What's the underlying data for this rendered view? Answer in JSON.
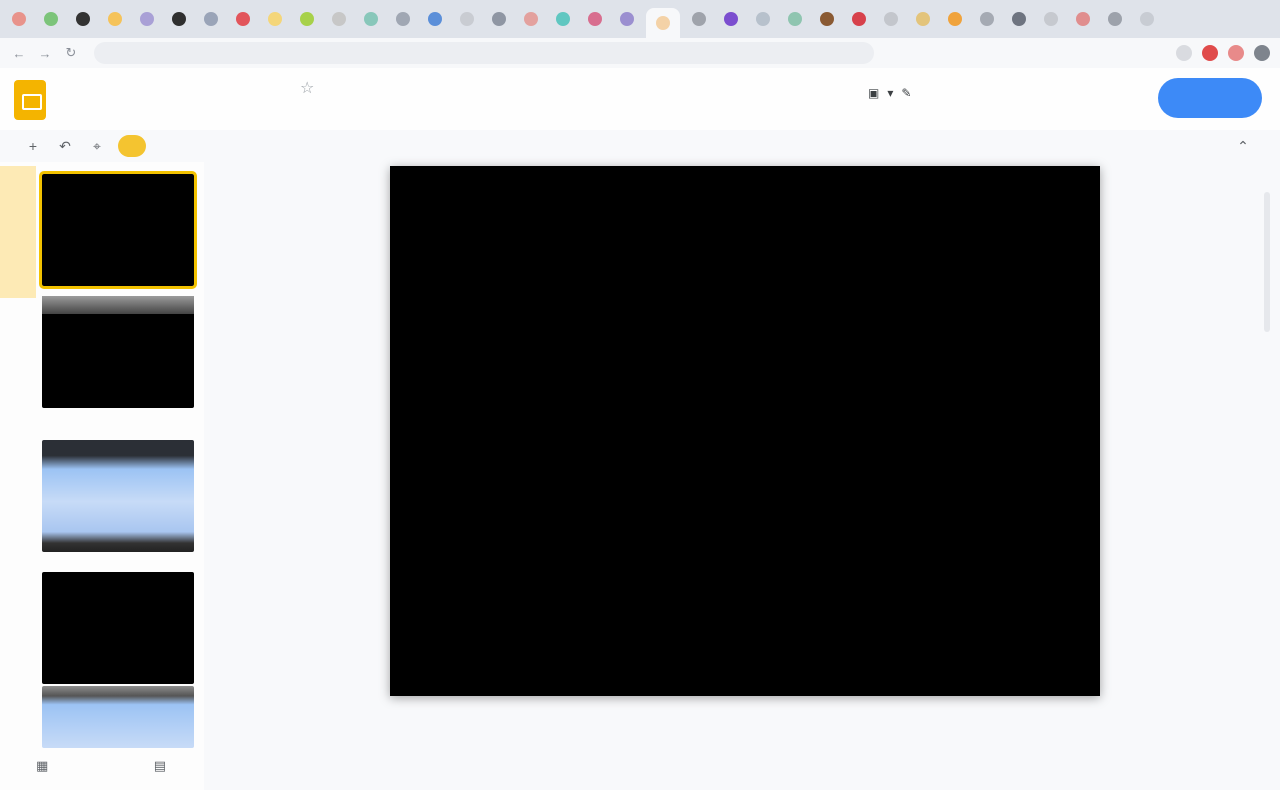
{
  "browser": {
    "tabs": [
      {
        "color": "#e8938b",
        "name": "red-circle-icon"
      },
      {
        "color": "#7cc47a",
        "name": "green-circle-icon"
      },
      {
        "color": "#333333",
        "name": "dark-circle-icon"
      },
      {
        "color": "#f5c35a",
        "name": "yellow-circle-icon"
      },
      {
        "color": "#a9a0d6",
        "name": "purple-circle-icon"
      },
      {
        "color": "#2f2f2f",
        "name": "github-icon"
      },
      {
        "color": "#9aa4b8",
        "name": "gray-circle-icon"
      },
      {
        "color": "#e2555b",
        "name": "red-circle-icon"
      },
      {
        "color": "#f4d67a",
        "name": "yellow-circle-icon"
      },
      {
        "color": "#a7d14a",
        "name": "lime-circle-icon"
      },
      {
        "color": "#c7c7c7",
        "name": "gray-circle-icon"
      },
      {
        "color": "#88c7ba",
        "name": "teal-circle-icon"
      },
      {
        "color": "#a0a7b3",
        "name": "gray-circle-icon"
      },
      {
        "color": "#5b8fd9",
        "name": "blue-circle-icon"
      },
      {
        "color": "#c9ccd2",
        "name": "gray-circle-icon"
      },
      {
        "color": "#8f96a3",
        "name": "gray-circle-icon"
      },
      {
        "color": "#e3a19e",
        "name": "pink-circle-icon"
      },
      {
        "color": "#60c7c1",
        "name": "teal-circle-icon"
      },
      {
        "color": "#d86e8f",
        "name": "pink-circle-icon"
      },
      {
        "color": "#9b8fd0",
        "name": "purple-circle-icon"
      },
      {
        "color": "#f4d2a7",
        "name": "slides-icon"
      },
      {
        "color": "#9fa3ab",
        "name": "gray-circle-icon"
      },
      {
        "color": "#7b4ecf",
        "name": "purple-circle-icon"
      },
      {
        "color": "#b7c1cc",
        "name": "gray-circle-icon"
      },
      {
        "color": "#8fc5b0",
        "name": "teal-circle-icon"
      },
      {
        "color": "#8a5a33",
        "name": "brown-circle-icon"
      },
      {
        "color": "#d7414b",
        "name": "red-circle-icon"
      },
      {
        "color": "#c3c6cc",
        "name": "gray-circle-icon"
      },
      {
        "color": "#e3c47b",
        "name": "yellow-circle-icon"
      },
      {
        "color": "#f0a33c",
        "name": "orange-circle-icon"
      },
      {
        "color": "#a5aab3",
        "name": "gray-circle-icon"
      },
      {
        "color": "#6e7480",
        "name": "gray-circle-icon"
      },
      {
        "color": "#c6c9cf",
        "name": "gray-circle-icon"
      },
      {
        "color": "#e08e8e",
        "name": "pink-circle-icon"
      },
      {
        "color": "#9da2ab",
        "name": "gray-circle-icon"
      },
      {
        "color": "#c8ccd3",
        "name": "gray-circle-icon"
      }
    ],
    "active_tab_index": 20,
    "extension_colors": [
      "#d9dbe0",
      "#e04b4b",
      "#e88a8a",
      "#7e848d"
    ]
  },
  "app": {
    "accent": "#f4b400",
    "share_color": "#3d8af7"
  },
  "thumbnails": [
    {
      "style": "black",
      "selected": true
    },
    {
      "style": "gray-top"
    },
    {
      "style": "blue"
    },
    {
      "style": "black"
    },
    {
      "style": "blue-partial"
    }
  ]
}
